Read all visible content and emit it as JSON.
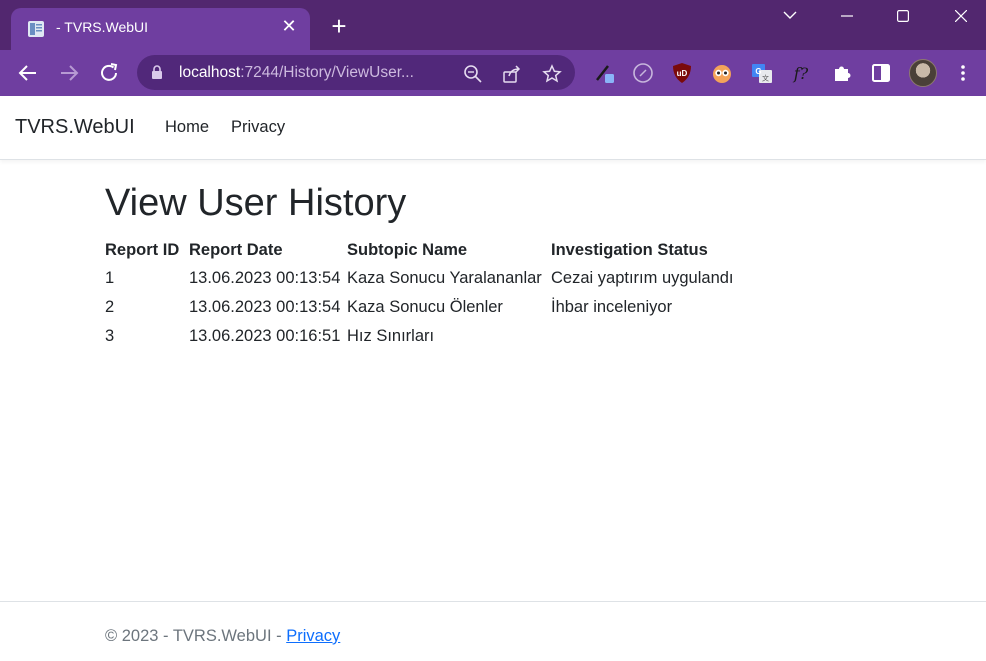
{
  "browser": {
    "tab_title": "- TVRS.WebUI",
    "url_host": "localhost",
    "url_path": ":7244/History/ViewUser..."
  },
  "navbar": {
    "brand": "TVRS.WebUI",
    "links": [
      "Home",
      "Privacy"
    ]
  },
  "main": {
    "title": "View User History",
    "table": {
      "headers": [
        "Report ID",
        "Report Date",
        "Subtopic Name",
        "Investigation Status"
      ],
      "rows": [
        [
          "1",
          "13.06.2023 00:13:54",
          "Kaza Sonucu Yaralananlar",
          "Cezai yaptırım uygulandı"
        ],
        [
          "2",
          "13.06.2023 00:13:54",
          "Kaza Sonucu Ölenler",
          "İhbar inceleniyor"
        ],
        [
          "3",
          "13.06.2023 00:16:51",
          "Hız Sınırları",
          ""
        ]
      ]
    }
  },
  "footer": {
    "text": "© 2023 - TVRS.WebUI - ",
    "link": "Privacy"
  },
  "colors": {
    "titlebar": "#52276f",
    "toolbar": "#6f3ea0",
    "link": "#0d6efd"
  }
}
